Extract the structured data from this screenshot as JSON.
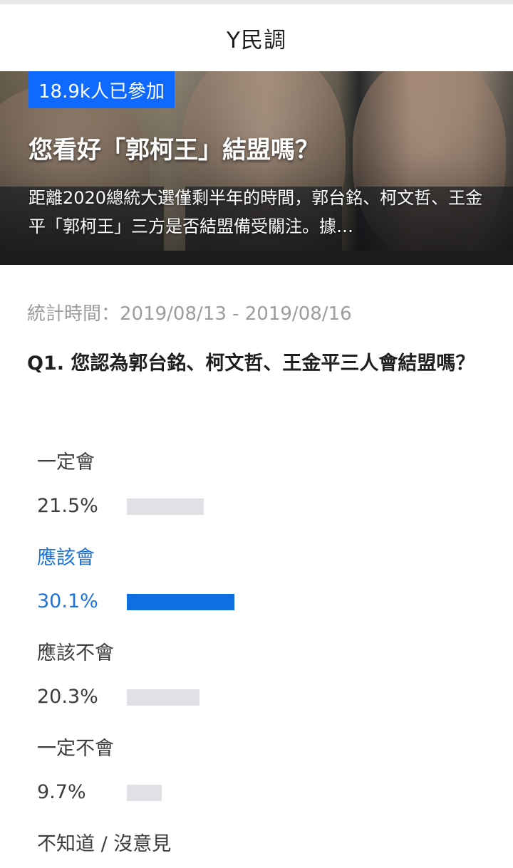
{
  "header": {
    "title": "Y民調"
  },
  "hero": {
    "participants": "18.9k人已參加",
    "title": "您看好「郭柯王」結盟嗎？",
    "description": "距離2020總統大選僅剩半年的時間，郭台銘、柯文哲、王金平「郭柯王」三方是否結盟備受關注。據…"
  },
  "stats": {
    "period": "統計時間：2019/08/13 - 2019/08/16"
  },
  "question": {
    "text": "Q1. 您認為郭台銘、柯文哲、王金平三人會結盟嗎？"
  },
  "options": [
    {
      "label": "一定會",
      "percent_text": "21.5%",
      "percent": 21.5,
      "selected": false
    },
    {
      "label": "應該會",
      "percent_text": "30.1%",
      "percent": 30.1,
      "selected": true
    },
    {
      "label": "應該不會",
      "percent_text": "20.3%",
      "percent": 20.3,
      "selected": false
    },
    {
      "label": "一定不會",
      "percent_text": "9.7%",
      "percent": 9.7,
      "selected": false
    },
    {
      "label": "不知道 / 沒意見",
      "percent_text": "",
      "percent": null,
      "selected": false
    }
  ],
  "colors": {
    "accent": "#0f6fe0",
    "badge": "#0f69ff",
    "bar_default": "#dfe1e6",
    "muted_text": "#9a9ca0"
  }
}
